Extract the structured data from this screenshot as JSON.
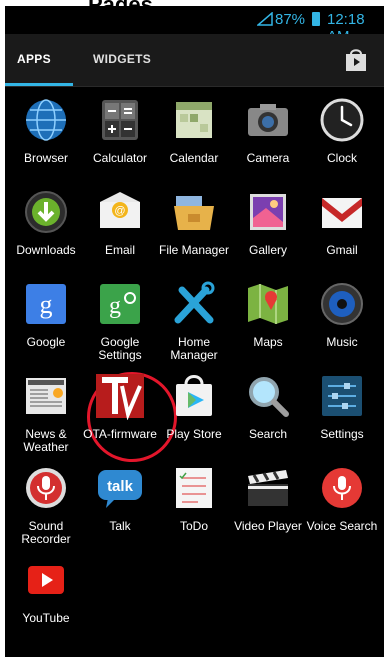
{
  "header_title": "Pages",
  "status": {
    "battery": "87%",
    "time": "12:18 AM"
  },
  "tabs": [
    "APPS",
    "WIDGETS"
  ],
  "apps": [
    {
      "label": "Browser",
      "icon": "globe-icon"
    },
    {
      "label": "Calculator",
      "icon": "calculator-icon"
    },
    {
      "label": "Calendar",
      "icon": "calendar-icon"
    },
    {
      "label": "Camera",
      "icon": "camera-icon"
    },
    {
      "label": "Clock",
      "icon": "clock-icon"
    },
    {
      "label": "Downloads",
      "icon": "download-icon"
    },
    {
      "label": "Email",
      "icon": "email-icon"
    },
    {
      "label": "File Manager",
      "icon": "folder-icon"
    },
    {
      "label": "Gallery",
      "icon": "gallery-icon"
    },
    {
      "label": "Gmail",
      "icon": "gmail-icon"
    },
    {
      "label": "Google",
      "icon": "google-icon"
    },
    {
      "label": "Google Settings",
      "icon": "google-settings-icon"
    },
    {
      "label": "Home Manager",
      "icon": "tools-icon"
    },
    {
      "label": "Maps",
      "icon": "maps-icon"
    },
    {
      "label": "Music",
      "icon": "music-icon"
    },
    {
      "label": "News & Weather",
      "icon": "news-icon"
    },
    {
      "label": "OTA-firmware",
      "icon": "ota-icon"
    },
    {
      "label": "Play Store",
      "icon": "play-store-icon"
    },
    {
      "label": "Search",
      "icon": "search-icon"
    },
    {
      "label": "Settings",
      "icon": "settings-icon"
    },
    {
      "label": "Sound Recorder",
      "icon": "microphone-icon"
    },
    {
      "label": "Talk",
      "icon": "talk-icon"
    },
    {
      "label": "ToDo",
      "icon": "todo-icon"
    },
    {
      "label": "Video Player",
      "icon": "video-icon"
    },
    {
      "label": "Voice Search",
      "icon": "voice-search-icon"
    },
    {
      "label": "YouTube",
      "icon": "youtube-icon"
    }
  ],
  "colors": {
    "accent": "#33b5e5",
    "highlight": "#e3162b"
  }
}
